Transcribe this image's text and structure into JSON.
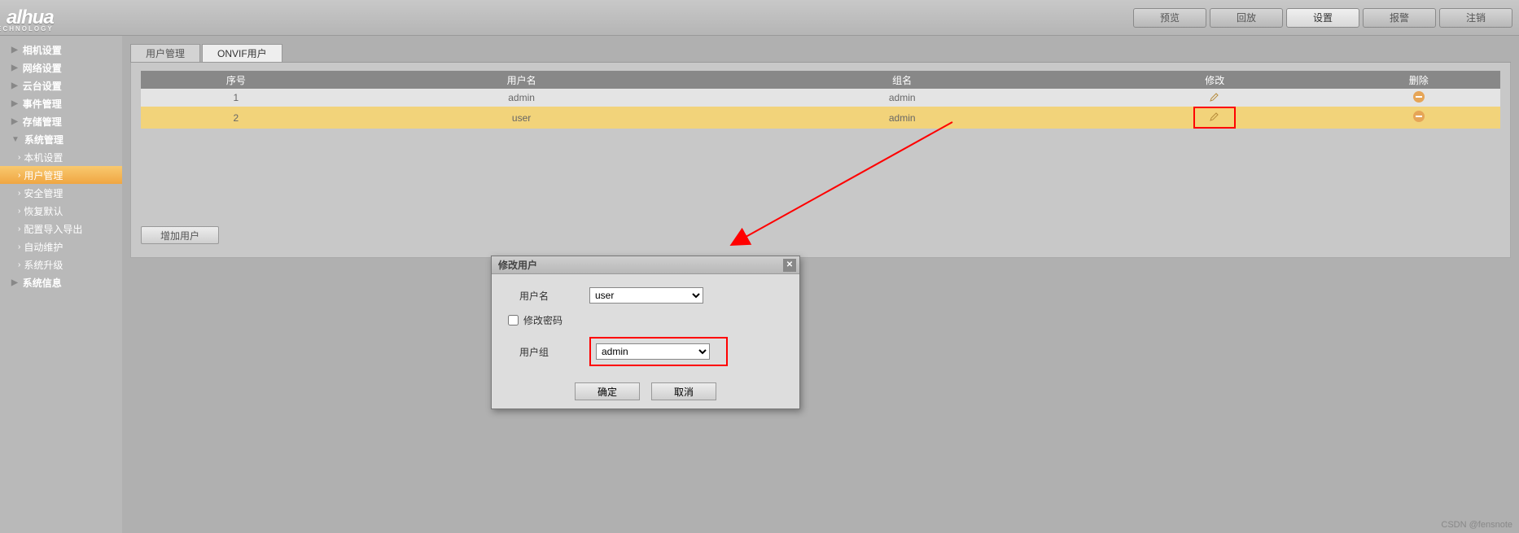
{
  "brand": {
    "name": "alhua",
    "sub": "TECHNOLOGY"
  },
  "topnav": {
    "preview": "预览",
    "playback": "回放",
    "setup": "设置",
    "alarm": "报警",
    "logout": "注销"
  },
  "sidebar": {
    "camera": "相机设置",
    "network": "网络设置",
    "ptz": "云台设置",
    "event": "事件管理",
    "storage": "存储管理",
    "system": "系统管理",
    "subs": {
      "general": "本机设置",
      "account": "用户管理",
      "safety": "安全管理",
      "default": "恢复默认",
      "impexp": "配置导入导出",
      "automaint": "自动维护",
      "upgrade": "系统升级"
    },
    "info": "系统信息"
  },
  "tabs": {
    "userMgmt": "用户管理",
    "onvifUser": "ONVIF用户"
  },
  "table": {
    "headers": {
      "no": "序号",
      "user": "用户名",
      "group": "组名",
      "edit": "修改",
      "delete": "删除"
    },
    "rows": [
      {
        "no": "1",
        "user": "admin",
        "group": "admin"
      },
      {
        "no": "2",
        "user": "user",
        "group": "admin"
      }
    ]
  },
  "buttons": {
    "addUser": "增加用户"
  },
  "dialog": {
    "title": "修改用户",
    "usernameLabel": "用户名",
    "usernameValue": "user",
    "modifyPwdLabel": "修改密码",
    "groupLabel": "用户组",
    "groupValue": "admin",
    "ok": "确定",
    "cancel": "取消"
  },
  "watermark": "CSDN @fensnote"
}
